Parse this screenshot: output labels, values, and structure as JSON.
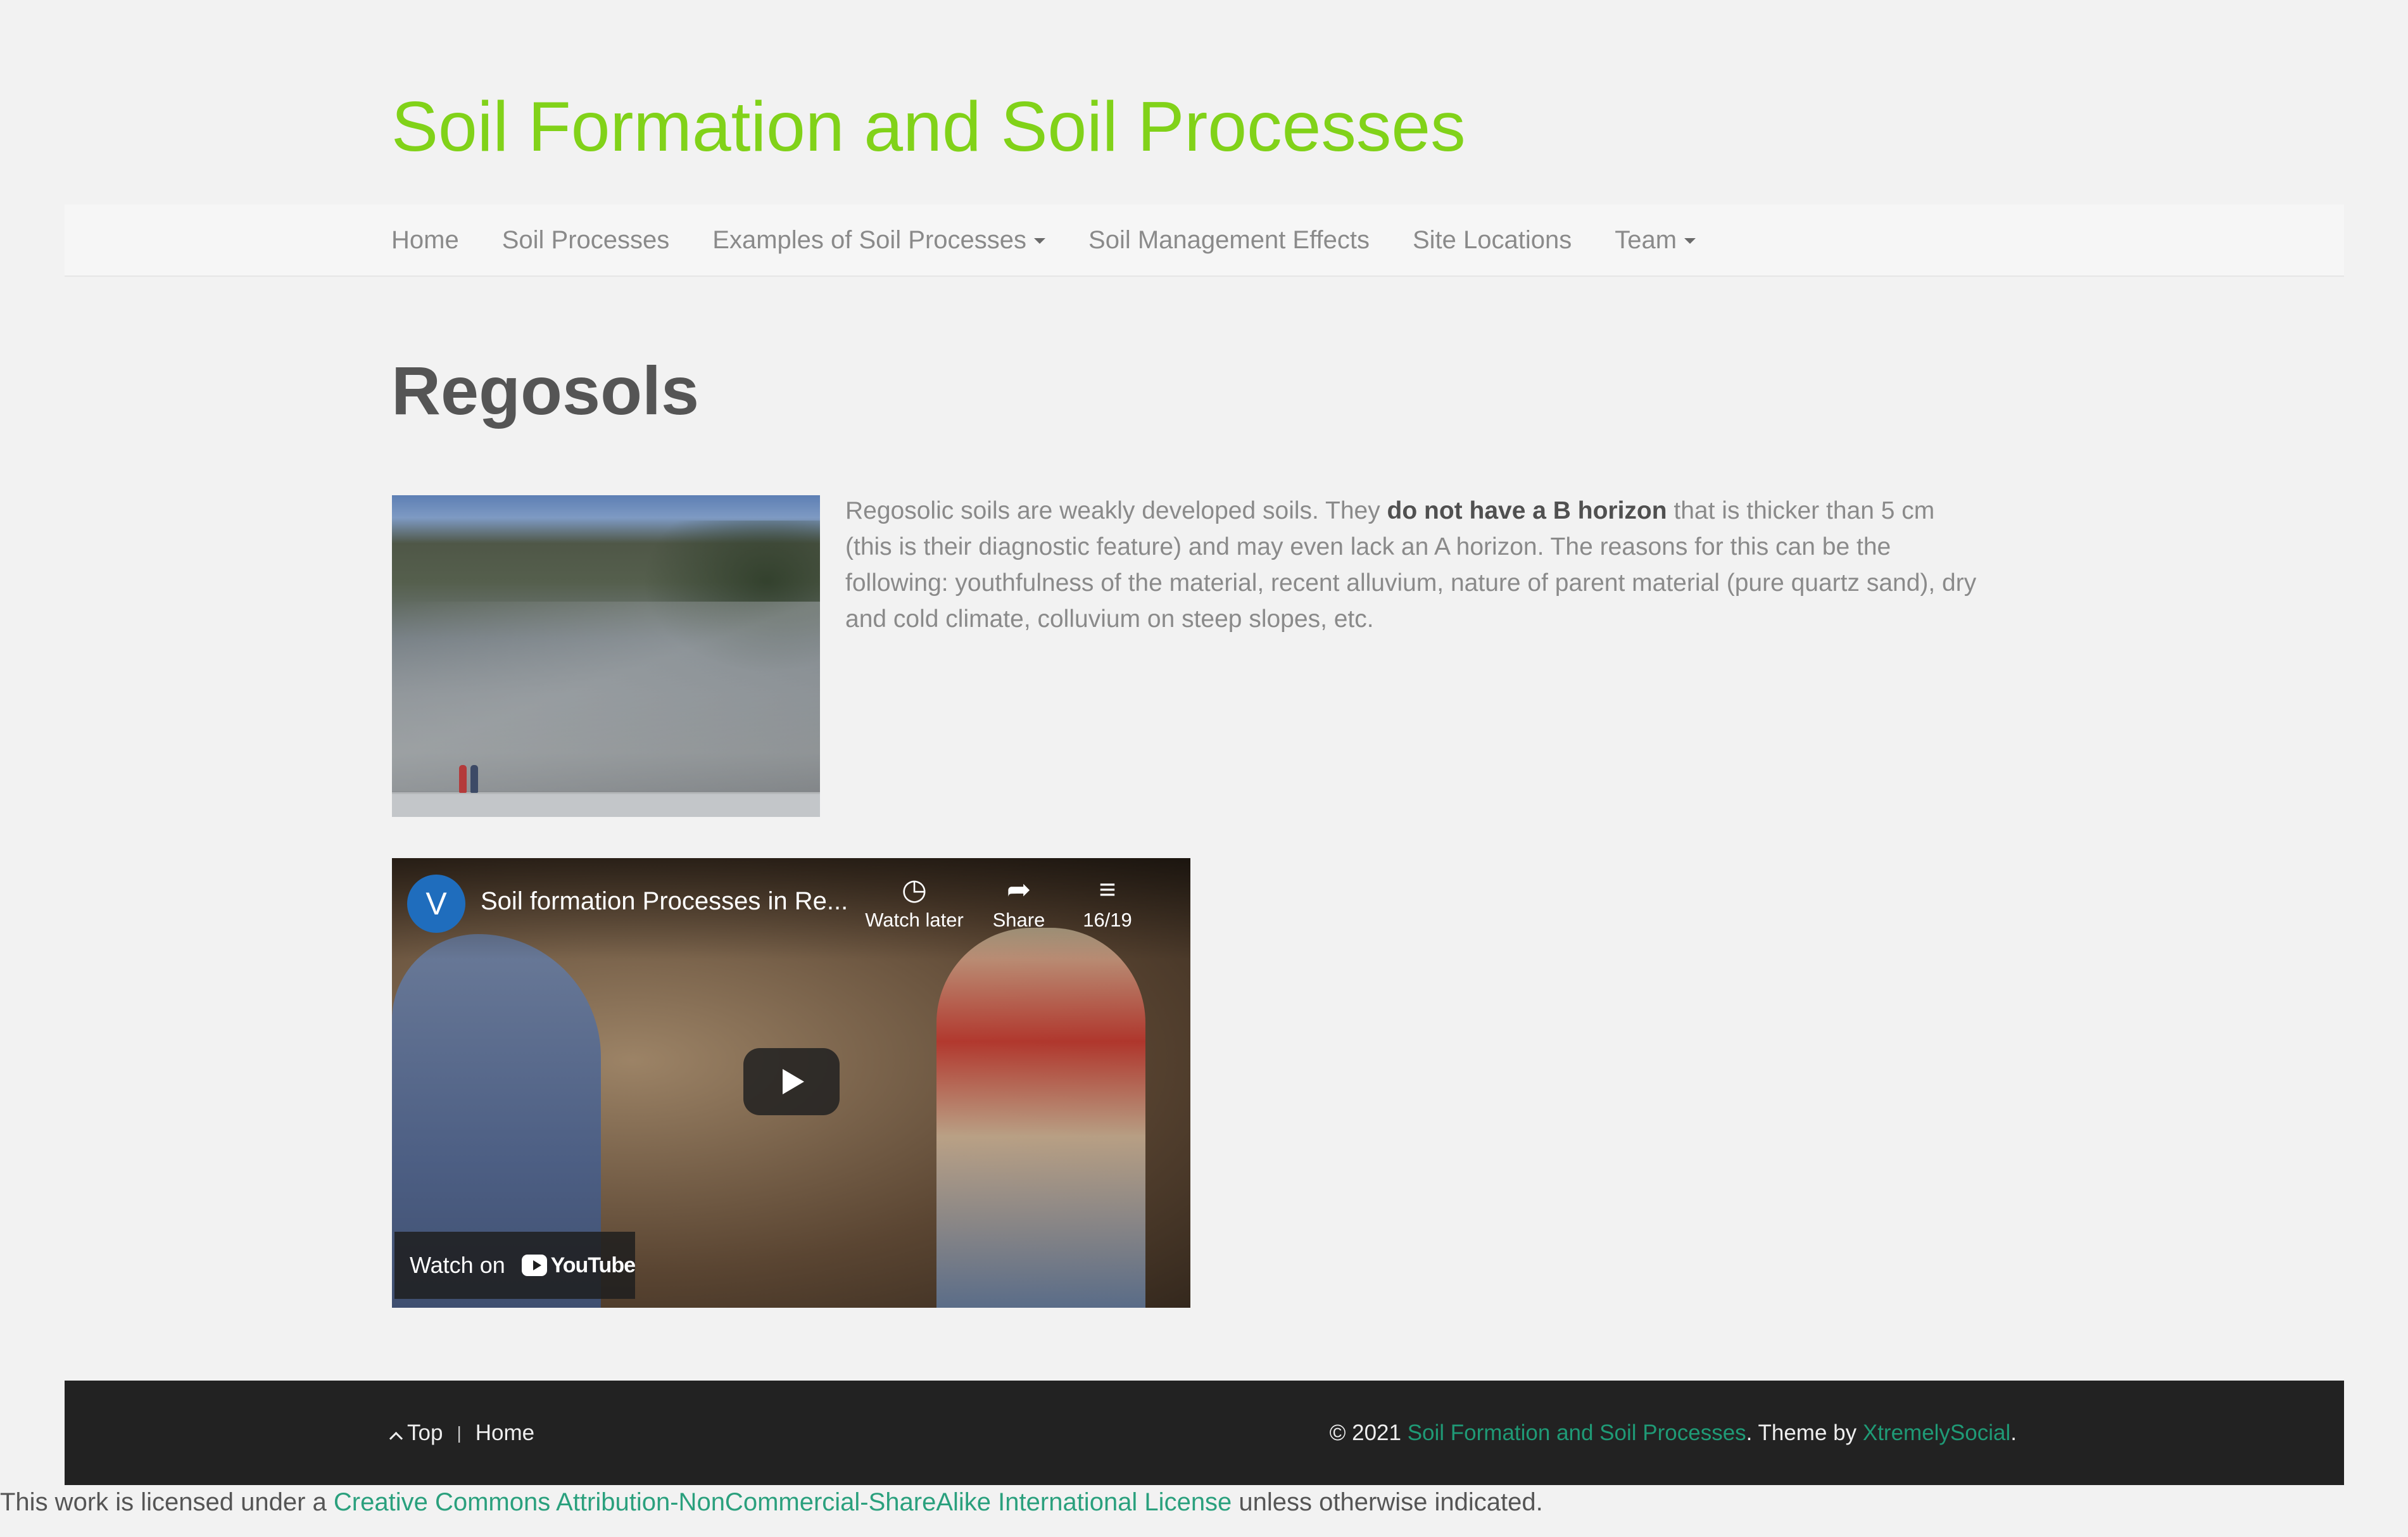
{
  "site": {
    "title": "Soil Formation and Soil Processes"
  },
  "nav": {
    "items": [
      {
        "label": "Home"
      },
      {
        "label": "Soil Processes"
      },
      {
        "label": "Examples of Soil Processes"
      },
      {
        "label": "Soil Management Effects"
      },
      {
        "label": "Site Locations"
      },
      {
        "label": "Team"
      }
    ]
  },
  "page": {
    "title": "Regosols",
    "intro_before": "Regosolic soils are weakly developed soils. They ",
    "intro_bold": "do not have a B horizon",
    "intro_after": " that is thicker than 5 cm (this is their diagnostic feature) and may even lack an A horizon. The reasons for this can be the following: youthfulness of the material, recent alluvium, nature of parent material (pure quartz sand), dry and cold climate, colluvium on steep slopes, etc."
  },
  "video": {
    "channel_initial": "V",
    "title": "Soil formation Processes in Re...",
    "watch_later": "Watch later",
    "share": "Share",
    "playlist_position": "16/19",
    "watch_on": "Watch on",
    "youtube_word": "YouTube"
  },
  "footer": {
    "top": "Top",
    "separator": "|",
    "home": "Home",
    "copyright_prefix": "© 2021 ",
    "site_link": "Soil Formation and Soil Processes",
    "theme_by": ". Theme by ",
    "theme_link": "XtremelySocial",
    "period": "."
  },
  "license": {
    "prefix": "This work is licensed under a ",
    "link": "Creative Commons Attribution-NonCommercial-ShareAlike International License",
    "suffix": " unless otherwise indicated."
  },
  "colors": {
    "site_title": "#81d219",
    "link_green": "#1f9a76",
    "footer_bg": "#222222",
    "page_bg": "#f2f2f2"
  }
}
